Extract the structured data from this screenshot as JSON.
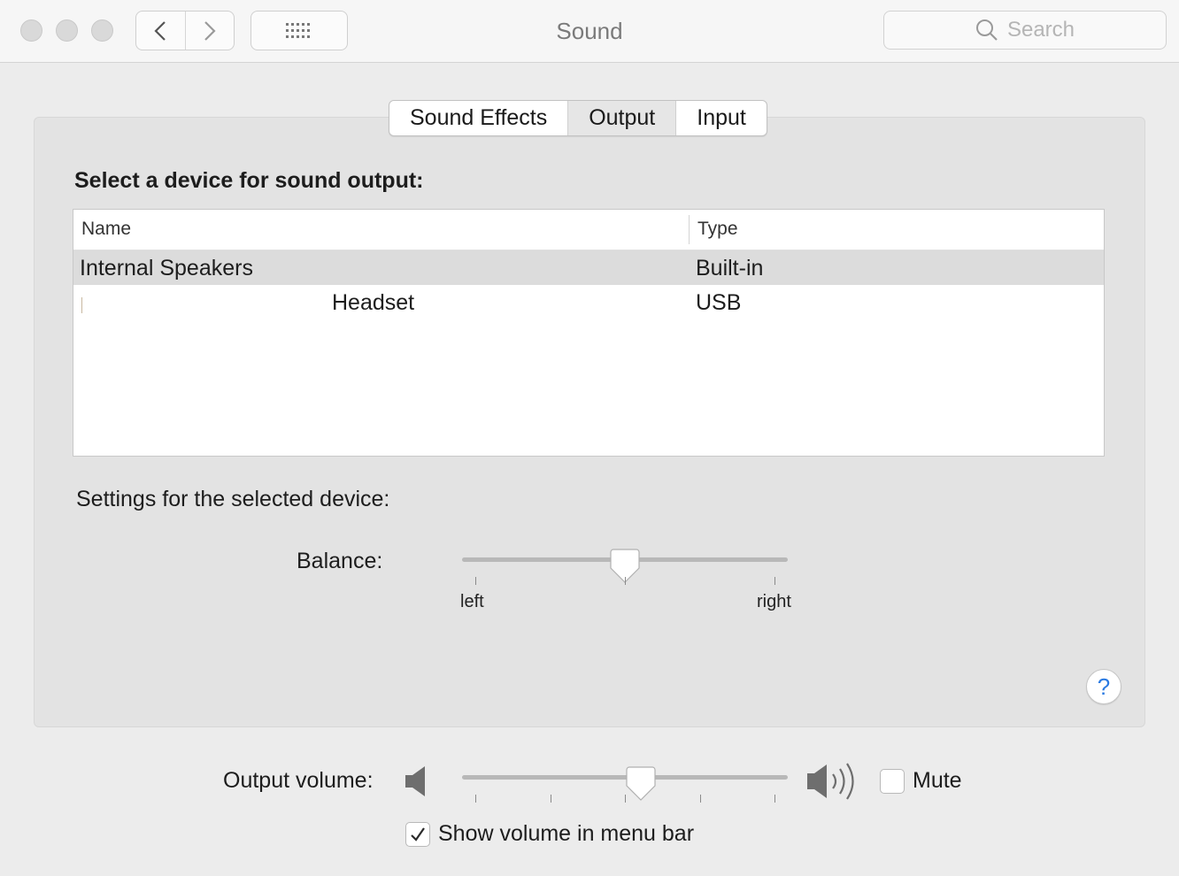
{
  "window": {
    "title": "Sound"
  },
  "search": {
    "placeholder": "Search"
  },
  "tabs": [
    {
      "label": "Sound Effects",
      "active": false
    },
    {
      "label": "Output",
      "active": true
    },
    {
      "label": "Input",
      "active": false
    }
  ],
  "output": {
    "section_title": "Select a device for sound output:",
    "columns": {
      "name": "Name",
      "type": "Type"
    },
    "devices": [
      {
        "name": "Internal Speakers",
        "type": "Built-in",
        "selected": true
      },
      {
        "name": "Headset",
        "type": "USB",
        "selected": false
      }
    ],
    "settings_label": "Settings for the selected device:",
    "balance": {
      "label": "Balance:",
      "left_label": "left",
      "right_label": "right",
      "value": 0.5
    }
  },
  "help": {
    "label": "?"
  },
  "volume": {
    "label": "Output volume:",
    "value": 0.55,
    "mute_label": "Mute",
    "muted": false,
    "show_in_menu_bar_label": "Show volume in menu bar",
    "show_in_menu_bar": true
  },
  "icons": {
    "back": "chevron-left-icon",
    "forward": "chevron-right-icon",
    "grid": "grid-icon",
    "search": "search-icon",
    "speaker_low": "speaker-low-icon",
    "speaker_high": "speaker-high-icon",
    "check": "checkmark-icon"
  },
  "colors": {
    "accent": "#2a7ae2",
    "selected_row": "#dcdcdc",
    "panel": "#e3e3e3"
  }
}
